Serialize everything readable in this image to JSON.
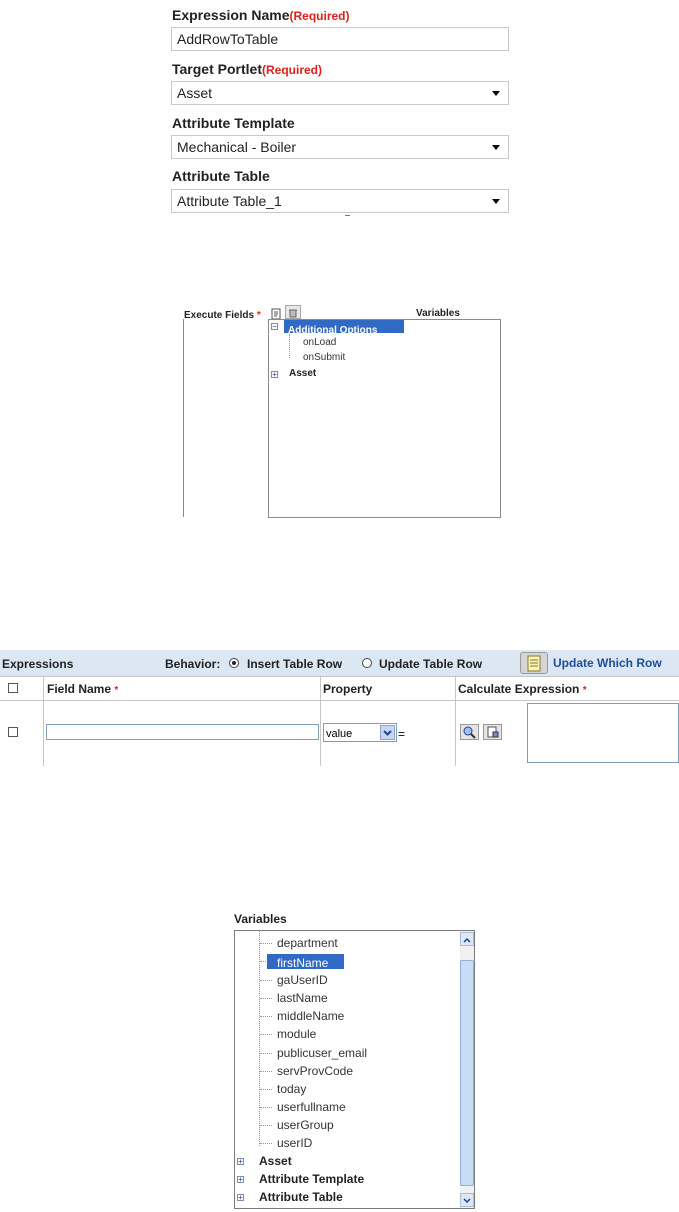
{
  "form": {
    "expression_name_label": "Expression Name",
    "expression_name_required": "(Required)",
    "expression_name_value": "AddRowToTable",
    "target_portlet_label": "Target Portlet",
    "target_portlet_required": "(Required)",
    "target_portlet_value": "Asset",
    "attribute_template_label": "Attribute Template",
    "attribute_template_value": "Mechanical - Boiler",
    "attribute_table_label": "Attribute Table",
    "attribute_table_value": "Attribute Table_1"
  },
  "tree_panel": {
    "execute_fields_label": "Execute Fields",
    "required_mark": "*",
    "variables_label": "Variables",
    "nodes": {
      "additional_options": "Additional Options",
      "onload": "onLoad",
      "onsubmit": "onSubmit",
      "asset": "Asset"
    }
  },
  "grid": {
    "title": "Expressions",
    "behavior_label": "Behavior:",
    "insert_table_row": "Insert Table Row",
    "update_table_row": "Update Table Row",
    "update_which_row": "Update Which Row",
    "columns": {
      "field_name": "Field Name",
      "property": "Property",
      "calculate_expression": "Calculate Expression"
    },
    "required_mark": "*",
    "row": {
      "field_name_value": "",
      "property_value": "value",
      "equals": "="
    }
  },
  "variables_panel": {
    "title": "Variables",
    "items": [
      "department",
      "firstName",
      "gaUserID",
      "lastName",
      "middleName",
      "module",
      "publicuser_email",
      "servProvCode",
      "today",
      "userfullname",
      "userGroup",
      "userID"
    ],
    "groups": [
      "Asset",
      "Attribute Template",
      "Attribute Table"
    ]
  },
  "colors": {
    "required": "#e0201a",
    "selection": "#316ac5",
    "grid_header": "#dbe7f3",
    "link": "#1f4e96"
  }
}
